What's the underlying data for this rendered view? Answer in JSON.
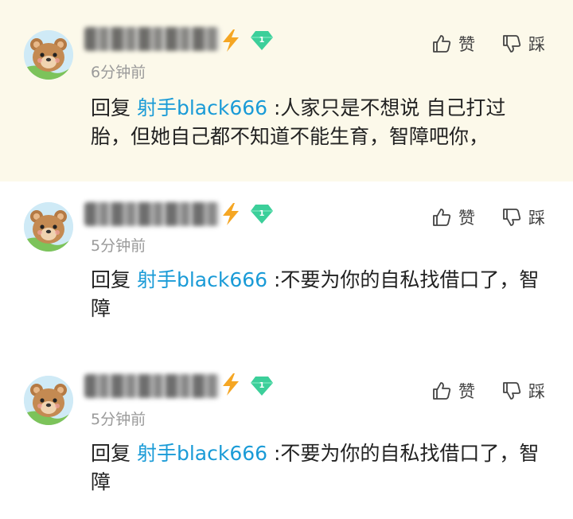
{
  "comments": [
    {
      "time": "6分钟前",
      "reply_prefix": "回复",
      "mention": "射手black666",
      "text": " :人家只是不想说 自己打过胎，但她自己都不知道不能生育，智障吧你，",
      "like_label": "赞",
      "dislike_label": "踩",
      "level_badge": "1"
    },
    {
      "time": "5分钟前",
      "reply_prefix": "回复",
      "mention": "射手black666",
      "text": " :不要为你的自私找借口了，智障",
      "like_label": "赞",
      "dislike_label": "踩",
      "level_badge": "1"
    },
    {
      "time": "5分钟前",
      "reply_prefix": "回复",
      "mention": "射手black666",
      "text": " :不要为你的自私找借口了，智障",
      "like_label": "赞",
      "dislike_label": "踩",
      "level_badge": "1"
    }
  ],
  "icons": {
    "avatar": "bear-avatar-icon",
    "vip": "lightning-bolt-icon",
    "level": "green-diamond-icon",
    "like": "thumbs-up-icon",
    "dislike": "thumbs-down-icon"
  },
  "colors": {
    "highlight_bg": "#fcf9ea",
    "mention": "#1a9bd7",
    "bolt": "#f5a623",
    "gem": "#3ccf9a",
    "time": "#9a9a9a"
  }
}
